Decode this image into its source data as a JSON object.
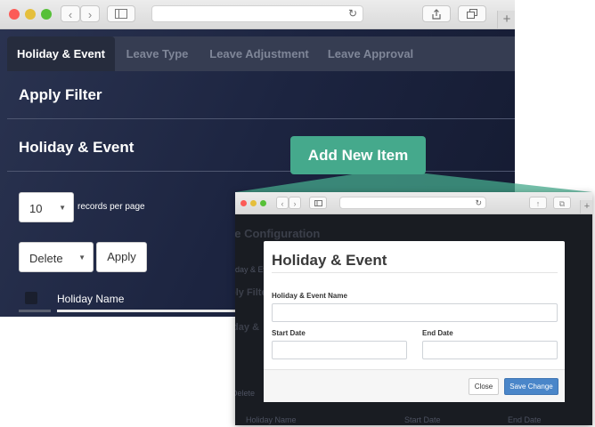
{
  "main_window": {
    "tabs": [
      {
        "label": "Holiday & Event"
      },
      {
        "label": "Leave Type"
      },
      {
        "label": "Leave Adjustment"
      },
      {
        "label": "Leave Approval"
      }
    ],
    "filter_title": "Apply Filter",
    "section_title": "Holiday & Event",
    "records_select": "10",
    "records_label": "records per page",
    "bulk_select": "Delete",
    "apply_label": "Apply",
    "table_header": {
      "holiday_name": "Holiday Name"
    }
  },
  "callout": {
    "label": "Add New Item"
  },
  "modal_window": {
    "background": {
      "page_title": "ve Configuration",
      "tab_fragment": "liday & Ev",
      "filter_fragment": "ply Filte",
      "section_fragment": "iday &",
      "select_fragment": "Delete",
      "table_headers": [
        "Holiday Name",
        "Start Date",
        "End Date"
      ]
    },
    "modal": {
      "title": "Holiday & Event",
      "name_label": "Holiday & Event Name",
      "start_label": "Start Date",
      "end_label": "End Date",
      "close_label": "Close",
      "save_label": "Save Change"
    }
  },
  "colors": {
    "accent_green": "#45a98c",
    "save_blue": "#4a86c9",
    "dark_bg": "#1c2440"
  },
  "icons": [
    "back-arrow-icon",
    "forward-arrow-icon",
    "sidebar-icon",
    "reload-icon",
    "share-icon",
    "tabs-icon",
    "plus-icon",
    "dropdown-caret-icon"
  ]
}
